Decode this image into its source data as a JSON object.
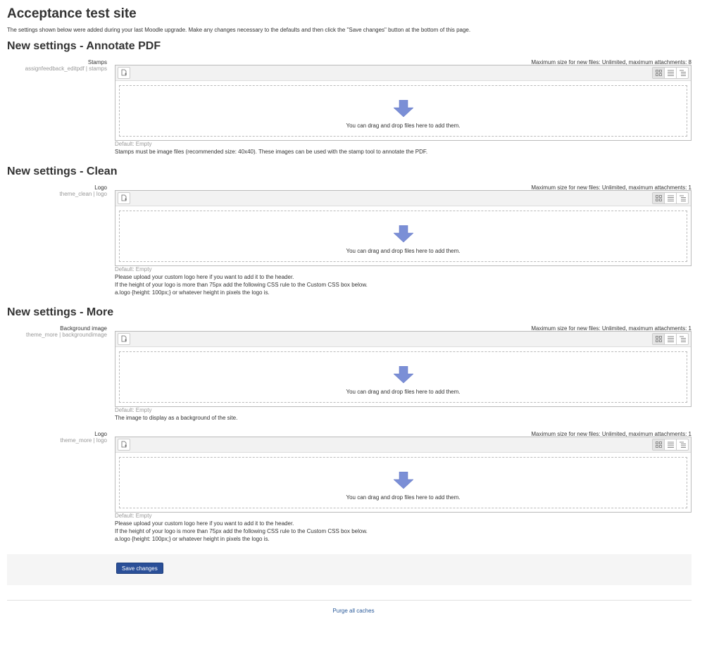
{
  "page": {
    "title": "Acceptance test site",
    "intro": "The settings shown below were added during your last Moodle upgrade. Make any changes necessary to the defaults and then click the \"Save changes\" button at the bottom of this page."
  },
  "sections": [
    {
      "heading": "New settings - Annotate PDF"
    },
    {
      "heading": "New settings - Clean"
    },
    {
      "heading": "New settings - More"
    }
  ],
  "settings": [
    {
      "name": "Stamps",
      "key": "assignfeedback_editpdf | stamps",
      "maxsize": "Maximum size for new files: Unlimited, maximum attachments: 8",
      "drop_text": "You can drag and drop files here to add them.",
      "default": "Default: Empty",
      "description": "Stamps must be image files (recommended size: 40x40). These images can be used with the stamp tool to annotate the PDF."
    },
    {
      "name": "Logo",
      "key": "theme_clean | logo",
      "maxsize": "Maximum size for new files: Unlimited, maximum attachments: 1",
      "drop_text": "You can drag and drop files here to add them.",
      "default": "Default: Empty",
      "description": "Please upload your custom logo here if you want to add it to the header.\nIf the height of your logo is more than 75px add the following CSS rule to the Custom CSS box below.\na.logo {height: 100px;} or whatever height in pixels the logo is."
    },
    {
      "name": "Background image",
      "key": "theme_more | backgroundimage",
      "maxsize": "Maximum size for new files: Unlimited, maximum attachments: 1",
      "drop_text": "You can drag and drop files here to add them.",
      "default": "Default: Empty",
      "description": "The image to display as a background of the site."
    },
    {
      "name": "Logo",
      "key": "theme_more | logo",
      "maxsize": "Maximum size for new files: Unlimited, maximum attachments: 1",
      "drop_text": "You can drag and drop files here to add them.",
      "default": "Default: Empty",
      "description": "Please upload your custom logo here if you want to add it to the header.\nIf the height of your logo is more than 75px add the following CSS rule to the Custom CSS box below.\na.logo {height: 100px;} or whatever height in pixels the logo is."
    }
  ],
  "actions": {
    "save_label": "Save changes",
    "purge_label": "Purge all caches"
  },
  "icons": {
    "add_file": "add-file-icon",
    "view_icons": "icons-view-icon",
    "view_details": "details-view-icon",
    "view_tree": "tree-view-icon",
    "drop_arrow": "down-arrow-icon"
  },
  "colors": {
    "primary_button": "#2a4f98",
    "link": "#2a5a9a",
    "drop_arrow": "#7b8fd6"
  }
}
